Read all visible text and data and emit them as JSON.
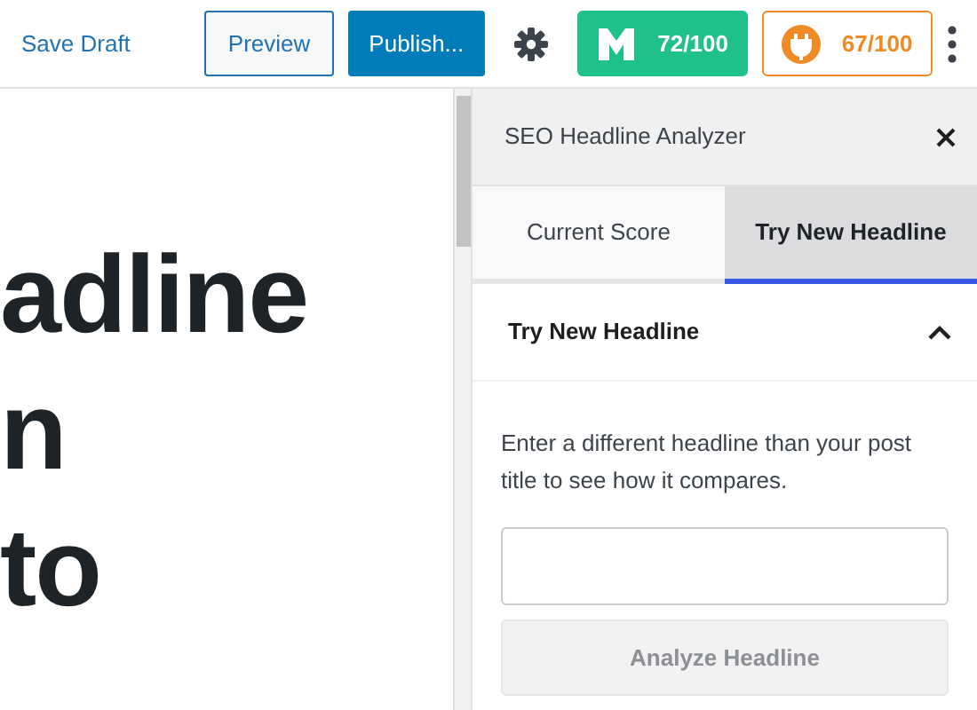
{
  "toolbar": {
    "save_draft": "Save Draft",
    "preview": "Preview",
    "publish": "Publish...",
    "scores": [
      {
        "kind": "monsterinsights",
        "label": "72/100"
      },
      {
        "kind": "aioseo",
        "label": "67/100"
      }
    ]
  },
  "editor": {
    "title_lines": [
      "adline",
      "n",
      "to"
    ]
  },
  "sidebar": {
    "title": "SEO Headline Analyzer",
    "tabs": [
      {
        "label": "Current Score",
        "selected": false
      },
      {
        "label": "Try New Headline",
        "selected": true
      }
    ],
    "section": {
      "title": "Try New Headline",
      "expanded": true,
      "description": "Enter a different headline than your post title to see how it compares.",
      "button": {
        "label": "Analyze Headline",
        "disabled": true
      }
    }
  }
}
